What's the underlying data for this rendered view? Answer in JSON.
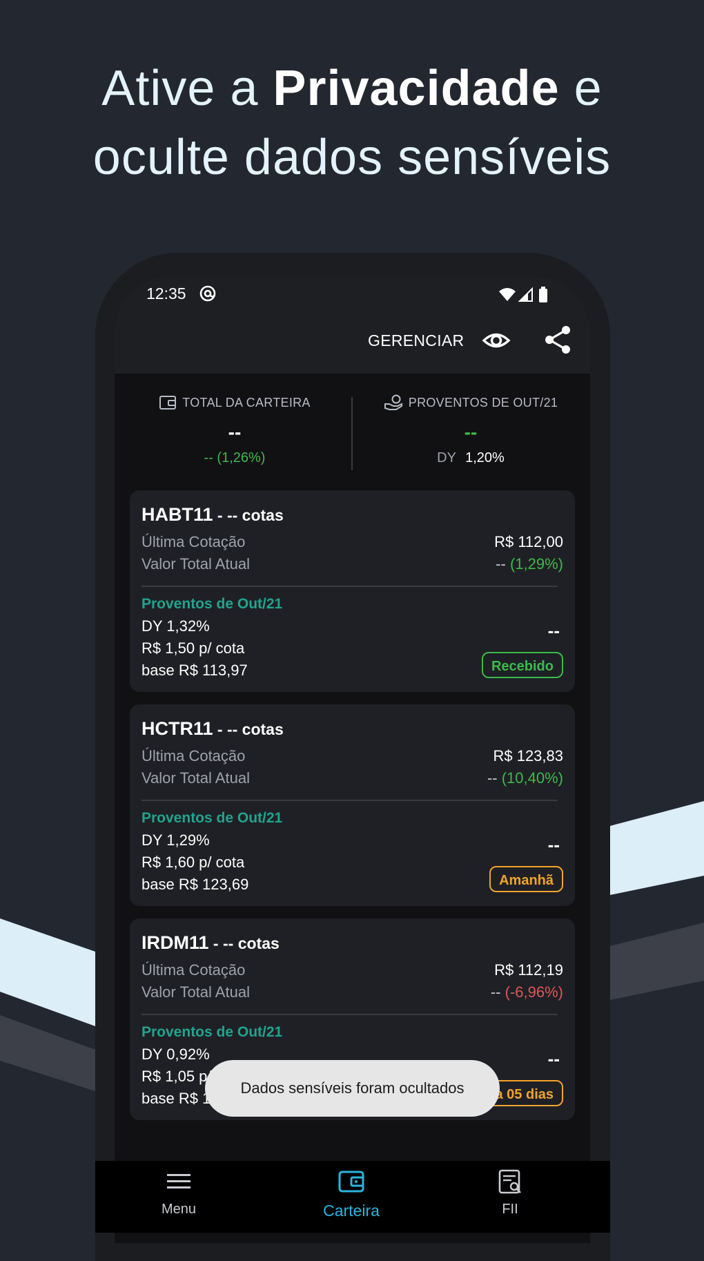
{
  "headline": {
    "part1": "Ative a ",
    "bold": "Privacidade",
    "part2": " e",
    "line2": "oculte dados sensíveis"
  },
  "status_bar": {
    "time": "12:35",
    "icons": [
      "at-icon",
      "wifi-icon",
      "signal-icon",
      "battery-icon"
    ]
  },
  "app_bar": {
    "manage_label": "GERENCIAR",
    "eye_icon": "eye-icon",
    "share_icon": "share-icon"
  },
  "summary": {
    "total": {
      "icon": "wallet-icon",
      "label": "TOTAL DA CARTEIRA",
      "value": "--",
      "change": "-- (1,26%)"
    },
    "dividends": {
      "icon": "hand-coin-icon",
      "label": "PROVENTOS DE OUT/21",
      "value": "--",
      "dy_label": "DY",
      "dy_value": "1,20%"
    }
  },
  "holdings": [
    {
      "ticker": "HABT11",
      "qty": " - -- cotas",
      "last_quote_label": "Última Cotação",
      "last_quote": "R$  112,00",
      "total_label": "Valor Total Atual",
      "total_value": "--",
      "total_change": "(1,29%)",
      "change_color": "green",
      "dividends_head": "Proventos de Out/21",
      "dy": "DY 1,32%",
      "per_share": "R$  1,50 p/ cota",
      "base": "base R$  113,97",
      "amount": "--",
      "status": "Recebido",
      "status_color": "green"
    },
    {
      "ticker": "HCTR11",
      "qty": " - -- cotas",
      "last_quote_label": "Última Cotação",
      "last_quote": "R$  123,83",
      "total_label": "Valor Total Atual",
      "total_value": "--",
      "total_change": "(10,40%)",
      "change_color": "green",
      "dividends_head": "Proventos de Out/21",
      "dy": "DY 1,29%",
      "per_share": "R$  1,60 p/ cota",
      "base": "base R$  123,69",
      "amount": "--",
      "status": "Amanhã",
      "status_color": "orange"
    },
    {
      "ticker": "IRDM11",
      "qty": " - -- cotas",
      "last_quote_label": "Última Cotação",
      "last_quote": "R$  112,19",
      "total_label": "Valor Total Atual",
      "total_value": "--",
      "total_change": "(-6,96%)",
      "change_color": "red",
      "dividends_head": "Proventos de Out/21",
      "dy": "DY 0,92%",
      "per_share": "R$  1,05 p/ cota",
      "base": "base R$  114,31",
      "amount": "--",
      "status": "Daqui a 05 dias",
      "status_color": "orange"
    }
  ],
  "toast": "Dados sensíveis foram ocultados",
  "bottom_nav": {
    "items": [
      {
        "label": "Menu",
        "icon": "menu-icon",
        "active": false
      },
      {
        "label": "Carteira",
        "icon": "wallet-icon",
        "active": true
      },
      {
        "label": "FII",
        "icon": "document-search-icon",
        "active": false
      }
    ],
    "active_color": "#29b6e0",
    "inactive_color": "#c9ccd1"
  }
}
